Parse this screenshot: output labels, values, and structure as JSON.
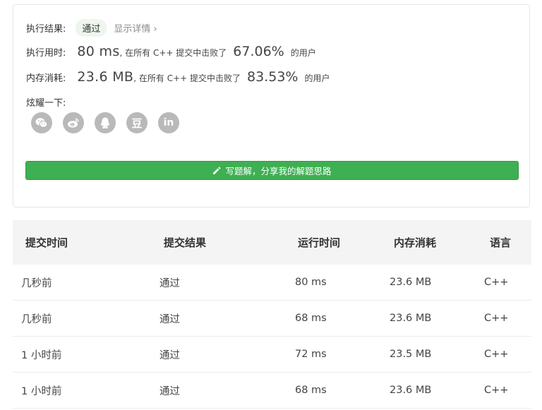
{
  "result": {
    "label": "执行结果:",
    "status": "通过",
    "details_link": "显示详情 ›"
  },
  "runtime": {
    "label": "执行用时:",
    "value": "80 ms",
    "text_before": ", 在所有 C++ 提交中击败了",
    "percent": "67.06%",
    "text_after": "的用户"
  },
  "memory": {
    "label": "内存消耗:",
    "value": "23.6 MB",
    "text_before": ", 在所有 C++ 提交中击败了",
    "percent": "83.53%",
    "text_after": "的用户"
  },
  "share": {
    "label": "炫耀一下:",
    "icons": [
      "wechat-icon",
      "weibo-icon",
      "qq-icon",
      "douban-icon",
      "linkedin-icon"
    ],
    "douban_glyph": "豆",
    "linkedin_glyph": "in"
  },
  "write_solution": {
    "label": "写题解，分享我的解题思路"
  },
  "colors": {
    "accent_green": "#3eaf52",
    "pass_green": "#43a047",
    "icon_gray": "#b9b9b9"
  },
  "table": {
    "headers": [
      "提交时间",
      "提交结果",
      "运行时间",
      "内存消耗",
      "语言"
    ],
    "rows": [
      [
        "几秒前",
        "通过",
        "80 ms",
        "23.6 MB",
        "C++"
      ],
      [
        "几秒前",
        "通过",
        "68 ms",
        "23.6 MB",
        "C++"
      ],
      [
        "1 小时前",
        "通过",
        "72 ms",
        "23.5 MB",
        "C++"
      ],
      [
        "1 小时前",
        "通过",
        "68 ms",
        "23.6 MB",
        "C++"
      ]
    ]
  }
}
